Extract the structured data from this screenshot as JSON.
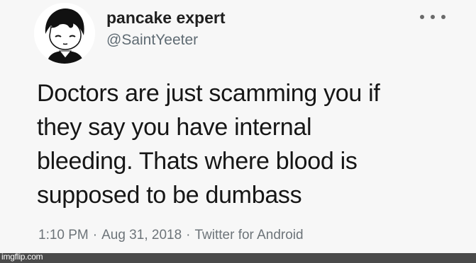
{
  "tweet": {
    "display_name": "pancake expert",
    "handle": "@SaintYeeter",
    "body": "Doctors are just scamming you if\nthey say you have internal\nbleeding. Thats where blood is\nsupposed to be dumbass",
    "time": "1:10 PM",
    "date": "Aug 31, 2018",
    "source": "Twitter for Android",
    "separator": "·",
    "more_icon": "more-dots-icon"
  },
  "watermark": {
    "text": "imgflip.com"
  },
  "colors": {
    "background": "#f7f7f7",
    "name": "#1f1f1f",
    "handle": "#5f6b73",
    "meta": "#6d7479",
    "footer_bar": "#4a4a4a"
  }
}
